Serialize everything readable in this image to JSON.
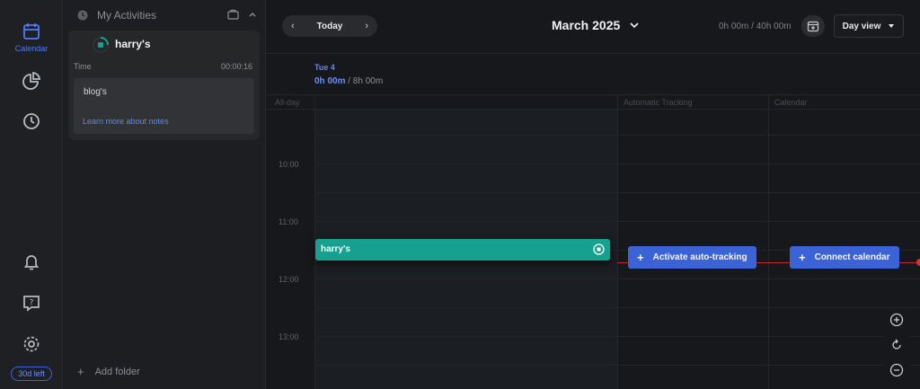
{
  "rail": {
    "calendar_label": "Calendar",
    "trial_badge": "30d left"
  },
  "panel": {
    "title": "My Activities",
    "activity": {
      "name": "harry's",
      "time_label": "Time",
      "time_value": "00:00:16",
      "note_text": "blog's",
      "note_link": "Learn more about notes"
    },
    "add_folder": "Add folder"
  },
  "topbar": {
    "today": "Today",
    "month": "March 2025",
    "hours": "0h 00m / 40h 00m",
    "view": "Day view"
  },
  "day": {
    "label": "Tue 4",
    "tracked": "0h 00m",
    "goal": " / 8h 00m"
  },
  "grid": {
    "allday": "All-day",
    "col_auto": "Automatic Tracking",
    "col_calendar": "Calendar",
    "times": [
      "10:00",
      "11:00",
      "12:00",
      "13:00"
    ]
  },
  "event": {
    "name": "harry's",
    "color": "#15a08f"
  },
  "buttons": {
    "auto_tracking": "Activate auto-tracking",
    "connect_calendar": "Connect calendar"
  },
  "colors": {
    "accent": "#3b63d6",
    "now_line": "#e02f2f"
  }
}
